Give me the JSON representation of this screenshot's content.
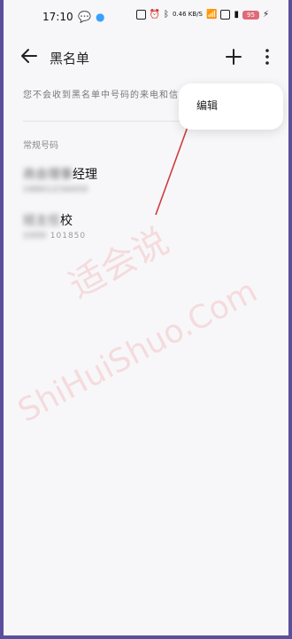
{
  "statusbar": {
    "time": "17:10",
    "net_speed": "0.46\nKB/S",
    "battery": "95"
  },
  "header": {
    "title": "黑名单",
    "back_icon": "back-arrow-icon",
    "add_icon": "plus-icon",
    "more_icon": "more-vertical-icon"
  },
  "info": {
    "text": "您不会收到黑名单中号码的来电和信"
  },
  "section": {
    "label": "常规号码"
  },
  "contacts": [
    {
      "name_blur": "商会理事",
      "name_visible": "经理",
      "number_blur": "18801234450",
      "number_visible": ""
    },
    {
      "name_blur": "班主任",
      "name_visible": "校",
      "number_blur": "1000",
      "number_visible": "101850"
    }
  ],
  "menu": {
    "edit_label": "编辑"
  },
  "watermark": {
    "cn": "适会说",
    "en": "ShiHuiShuo.Com"
  },
  "colors": {
    "screen_bg": "#f7f7f9",
    "annotation": "#d13a3a",
    "frame": "#5a4f9c"
  }
}
